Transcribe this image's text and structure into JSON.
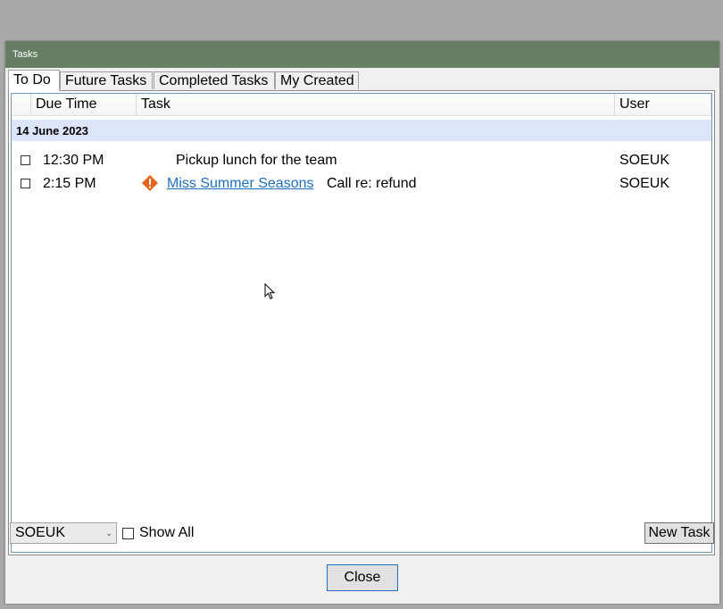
{
  "window": {
    "title": "Tasks"
  },
  "tabs": [
    {
      "label": "To Do",
      "active": true
    },
    {
      "label": "Future Tasks",
      "active": false
    },
    {
      "label": "Completed Tasks",
      "active": false
    },
    {
      "label": "My Created",
      "active": false
    }
  ],
  "columns": {
    "due_time": "Due Time",
    "task": "Task",
    "user": "User"
  },
  "group": {
    "label": "14 June 2023"
  },
  "rows": [
    {
      "checked": false,
      "time": "12:30 PM",
      "task": "Pickup lunch for the team",
      "user": "SOEUK"
    },
    {
      "checked": false,
      "time": "2:15 PM",
      "icon": "warning-icon",
      "contact": "Miss Summer Seasons",
      "note": "Call re: refund",
      "user": "SOEUK"
    }
  ],
  "footer": {
    "user_select": "SOEUK",
    "show_all_label": "Show All",
    "show_all_checked": false,
    "new_task_label": "New Task",
    "close_label": "Close"
  },
  "colors": {
    "titlebar": "#677e64",
    "group_row": "#dde5fb",
    "link": "#1f6fbf",
    "warning": "#e8641b"
  }
}
